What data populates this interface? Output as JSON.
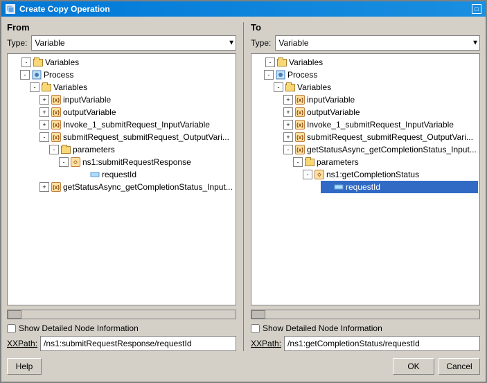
{
  "window": {
    "title": "Create Copy Operation",
    "icon": "copy-icon"
  },
  "from_panel": {
    "title": "From",
    "type_label": "Type:",
    "type_value": "Variable",
    "type_options": [
      "Variable"
    ],
    "tree": {
      "nodes": [
        {
          "id": "vars1",
          "label": "Variables",
          "type": "folder",
          "level": 0,
          "expanded": true
        },
        {
          "id": "proc1",
          "label": "Process",
          "type": "process",
          "level": 1,
          "expanded": true
        },
        {
          "id": "vars2",
          "label": "Variables",
          "type": "folder",
          "level": 2,
          "expanded": true
        },
        {
          "id": "input1",
          "label": "inputVariable",
          "type": "variable",
          "level": 3
        },
        {
          "id": "output1",
          "label": "outputVariable",
          "type": "variable",
          "level": 3
        },
        {
          "id": "invoke1",
          "label": "Invoke_1_submitRequest_InputVariable",
          "type": "variable",
          "level": 3
        },
        {
          "id": "submit1",
          "label": "submitRequest_submitRequest_OutputVari...",
          "type": "variable",
          "level": 3,
          "expanded": true
        },
        {
          "id": "params1",
          "label": "parameters",
          "type": "folder",
          "level": 4,
          "expanded": true
        },
        {
          "id": "ns1submit",
          "label": "ns1:submitRequestResponse",
          "type": "variable",
          "level": 5,
          "expanded": true
        },
        {
          "id": "requestId1",
          "label": "requestId",
          "type": "leaf",
          "level": 6,
          "selected": false
        },
        {
          "id": "getStatus1",
          "label": "getStatusAsync_getCompletionStatus_Input...",
          "type": "variable",
          "level": 3
        }
      ]
    },
    "show_detailed": "Show Detailed Node Information",
    "xpath_label": "XPath:",
    "xpath_value": "/ns1:submitRequestResponse/requestId"
  },
  "to_panel": {
    "title": "To",
    "type_label": "Type:",
    "type_value": "Variable",
    "type_options": [
      "Variable"
    ],
    "tree": {
      "nodes": [
        {
          "id": "vars1",
          "label": "Variables",
          "type": "folder",
          "level": 0,
          "expanded": true
        },
        {
          "id": "proc1",
          "label": "Process",
          "type": "process",
          "level": 1,
          "expanded": true
        },
        {
          "id": "vars2",
          "label": "Variables",
          "type": "folder",
          "level": 2,
          "expanded": true
        },
        {
          "id": "input1",
          "label": "inputVariable",
          "type": "variable",
          "level": 3
        },
        {
          "id": "output1",
          "label": "outputVariable",
          "type": "variable",
          "level": 3
        },
        {
          "id": "invoke1",
          "label": "Invoke_1_submitRequest_InputVariable",
          "type": "variable",
          "level": 3
        },
        {
          "id": "submit1",
          "label": "submitRequest_submitRequest_OutputVari...",
          "type": "variable",
          "level": 3
        },
        {
          "id": "getStatus2",
          "label": "getStatusAsync_getCompletionStatus_Input...",
          "type": "variable",
          "level": 3,
          "expanded": true
        },
        {
          "id": "params2",
          "label": "parameters",
          "type": "folder",
          "level": 4,
          "expanded": true
        },
        {
          "id": "ns1get",
          "label": "ns1:getCompletionStatus",
          "type": "variable",
          "level": 5,
          "expanded": true
        },
        {
          "id": "requestId2",
          "label": "requestId",
          "type": "leaf",
          "level": 6,
          "selected": true
        }
      ]
    },
    "show_detailed": "Show Detailed Node Information",
    "xpath_label": "XPath:",
    "xpath_value": "/ns1:getCompletionStatus/requestId"
  },
  "buttons": {
    "help": "Help",
    "ok": "OK",
    "cancel": "Cancel"
  }
}
